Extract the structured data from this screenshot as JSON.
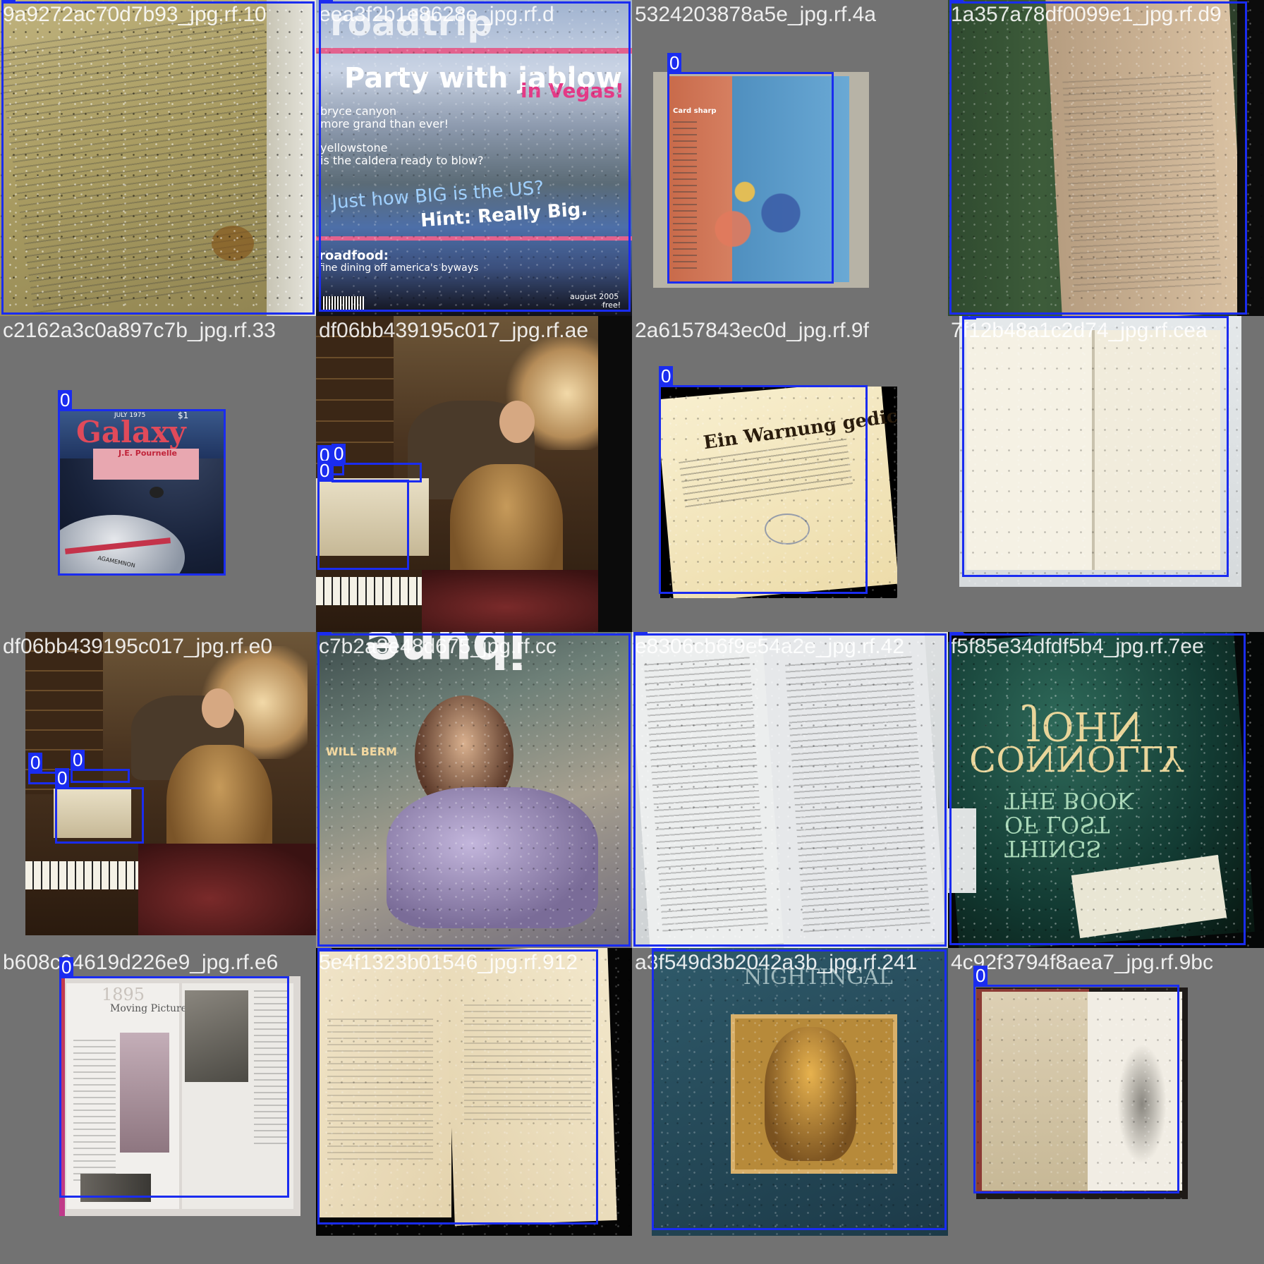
{
  "tiles": [
    {
      "title": "9a9272ac70d7b93_jpg.rf.10",
      "labels": [
        "0"
      ]
    },
    {
      "title": "eea3f2b1e8628e_jpg.rf.d",
      "labels": [
        "0"
      ]
    },
    {
      "title": "5324203878a5e_jpg.rf.4a",
      "labels": [
        "0"
      ]
    },
    {
      "title": "1a357a78df0099e1_jpg.rf.d9",
      "labels": [
        "0"
      ]
    },
    {
      "title": "c2162a3c0a897c7b_jpg.rf.33",
      "labels": [
        "0"
      ]
    },
    {
      "title": "df06bb439195c017_jpg.rf.ae",
      "labels": [
        "0",
        "0",
        "0"
      ]
    },
    {
      "title": "2a6157843ec0d_jpg.rf.9f",
      "labels": [
        "0"
      ]
    },
    {
      "title": "7f12b48a1c2d74_jpg.rf.cea",
      "labels": [
        "0"
      ]
    },
    {
      "title": "df06bb439195c017_jpg.rf.e0",
      "labels": [
        "0",
        "0",
        "0"
      ]
    },
    {
      "title": "c7b2a3e48d675_jpg.rf.cc",
      "labels": [
        "0"
      ]
    },
    {
      "title": "e8306cb6f9e54a2e_jpg.rf.42",
      "labels": [
        "0"
      ]
    },
    {
      "title": "f5f85e34dfdf5b4_jpg.rf.7ee",
      "labels": [
        "0"
      ]
    },
    {
      "title": "b608c94619d226e9_jpg.rf.e6",
      "labels": [
        "0"
      ]
    },
    {
      "title": "5e4f1323b01546_jpg.rf.912",
      "labels": [
        "0"
      ]
    },
    {
      "title": "a3f549d3b2042a3b_jpg.rf.241",
      "labels": [
        "0"
      ]
    },
    {
      "title": "4c92f3794f8aea7_jpg.rf.9bc",
      "labels": [
        "0"
      ]
    }
  ],
  "printed_text": {
    "magazine_logo": "roadtrip",
    "magazine_headline": "Party with jablow",
    "magazine_headline2": "in Vegas!",
    "magazine_line1": "bryce canyon",
    "magazine_line2": "more grand than ever!",
    "magazine_line3": "yellowstone",
    "magazine_line4": "is the caldera ready to blow?",
    "magazine_big": "Just how BIG is the US?",
    "magazine_hint": "Hint: Really Big.",
    "magazine_food": "roadfood:",
    "magazine_food_sub": "fine dining off america's byways",
    "magazine_date": "august 2005",
    "magazine_free": "free!",
    "card_sharp": "Card sharp",
    "galaxy_logo": "Galaxy",
    "galaxy_author": "J.E. Pournelle",
    "galaxy_date": "JULY 1975",
    "galaxy_price": "$1",
    "galaxy_ship": "AGAMEMNON",
    "old_print_title": "Ein Warnung gedicht",
    "cover_letters": "ibune",
    "cover_side": "WILL BERM",
    "jc_name1": "JOHN",
    "jc_name2": "CONNOLLY",
    "jc_title1": "THE BOOK",
    "jc_title2": "OF LOST",
    "jc_title3": "THINGS",
    "mp_year": "1895",
    "mp_title": "Moving Pictures",
    "fn_title": "NIGHTINGAL"
  }
}
